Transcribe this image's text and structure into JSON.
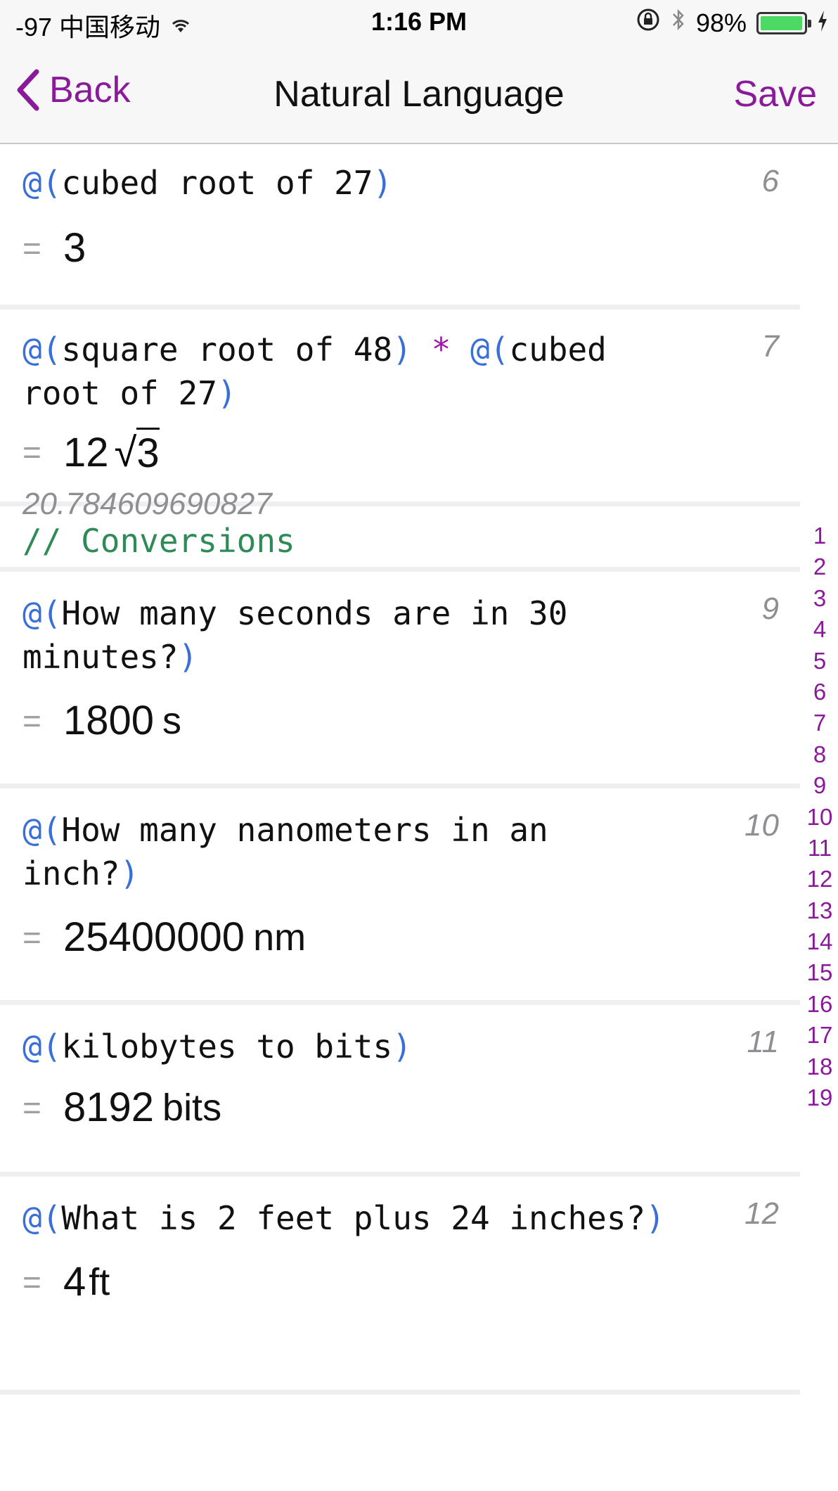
{
  "status": {
    "carrier": "-97 中国移动",
    "time": "1:16 PM",
    "battery": "98%",
    "battery_level": 0.98,
    "accent": "#4cd964"
  },
  "nav": {
    "back_label": "Back",
    "title": "Natural Language",
    "save_label": "Save",
    "accent": "#8a1a9a"
  },
  "entries": [
    {
      "num": "6",
      "expr_a": "@(",
      "expr_b": "cubed root of 27",
      "expr_c": ")",
      "eq": "=",
      "value": "3"
    },
    {
      "num": "7",
      "expr_open1": "@(",
      "expr_text1": "square root of 48",
      "expr_close1": ")",
      "op": " * ",
      "expr_open2": "@(",
      "expr_text2": "cubed root of 27",
      "expr_close2": ")",
      "eq": "=",
      "coef": "12",
      "radicand": "3",
      "decimal": "20.784609690827"
    },
    {
      "comment": "// Conversions"
    },
    {
      "num": "9",
      "expr_a": "@(",
      "expr_b": "How many seconds are in 30 minutes?",
      "expr_c": ")",
      "eq": "=",
      "value": "1800",
      "unit": "s"
    },
    {
      "num": "10",
      "expr_a": "@(",
      "expr_b": "How many nanometers in an inch?",
      "expr_c": ")",
      "eq": "=",
      "value": "25400000",
      "unit": "nm"
    },
    {
      "num": "11",
      "expr_a": "@(",
      "expr_b": "kilobytes to bits",
      "expr_c": ")",
      "eq": "=",
      "value": "8192",
      "unit": "bits"
    },
    {
      "num": "12",
      "expr_a": "@(",
      "expr_b": "What is 2 feet plus 24 inches?",
      "expr_c": ")",
      "eq": "=",
      "value": "4",
      "unit": "ft"
    }
  ],
  "index": [
    "1",
    "2",
    "3",
    "4",
    "5",
    "6",
    "7",
    "8",
    "9",
    "10",
    "11",
    "12",
    "13",
    "14",
    "15",
    "16",
    "17",
    "18",
    "19"
  ]
}
